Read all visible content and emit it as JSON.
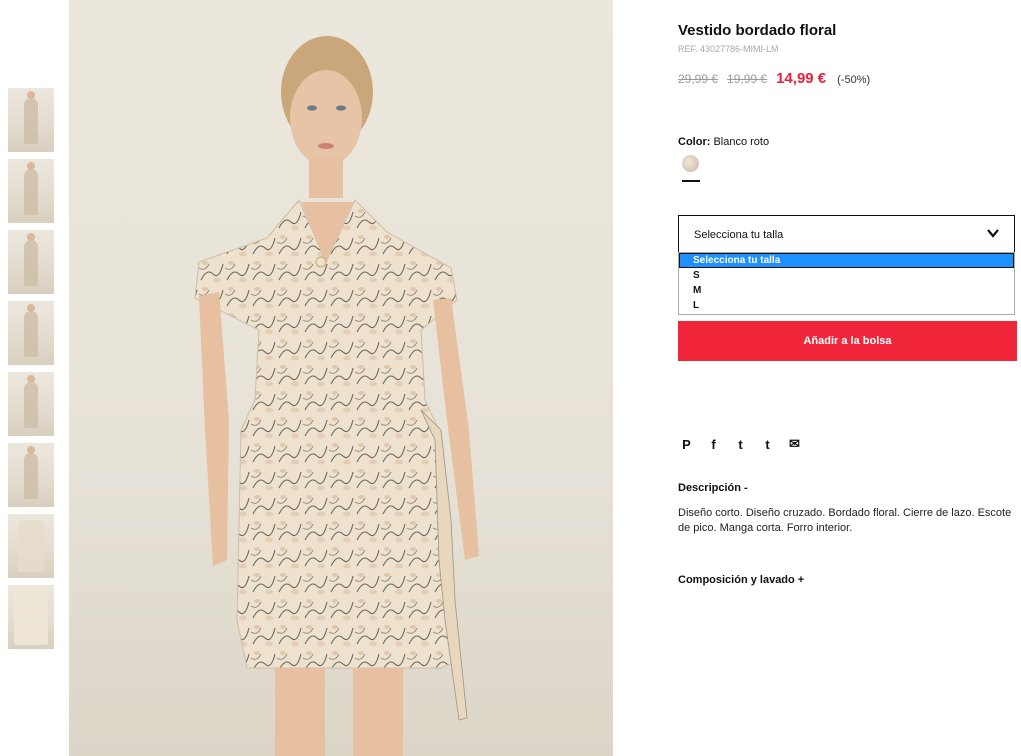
{
  "product": {
    "title": "Vestido bordado floral",
    "ref": "REF. 43027786-MIMI-LM",
    "price_original": "29,99 €",
    "price_previous": "19,99 €",
    "price_current": "14,99 €",
    "discount": "(-50%)"
  },
  "color": {
    "label": "Color:",
    "value": "Blanco roto"
  },
  "size_select": {
    "selected": "Selecciona tu talla",
    "options": [
      "Selecciona tu talla",
      "S",
      "M",
      "L"
    ]
  },
  "add_to_bag": "Añadir a la bolsa",
  "social": {
    "pinterest": "P",
    "facebook": "f",
    "twitter": "t",
    "tumblr": "t",
    "email": "✉"
  },
  "description": {
    "heading": "Descripción -",
    "text": "Diseño corto. Diseño cruzado. Bordado floral. Cierre de lazo. Escote de pico. Manga corta. Forro interior."
  },
  "composition": {
    "heading": "Composición y lavado +"
  },
  "colors": {
    "accent_red": "#f2263b",
    "price_red": "#e8203a",
    "select_highlight": "#1e90ff"
  }
}
